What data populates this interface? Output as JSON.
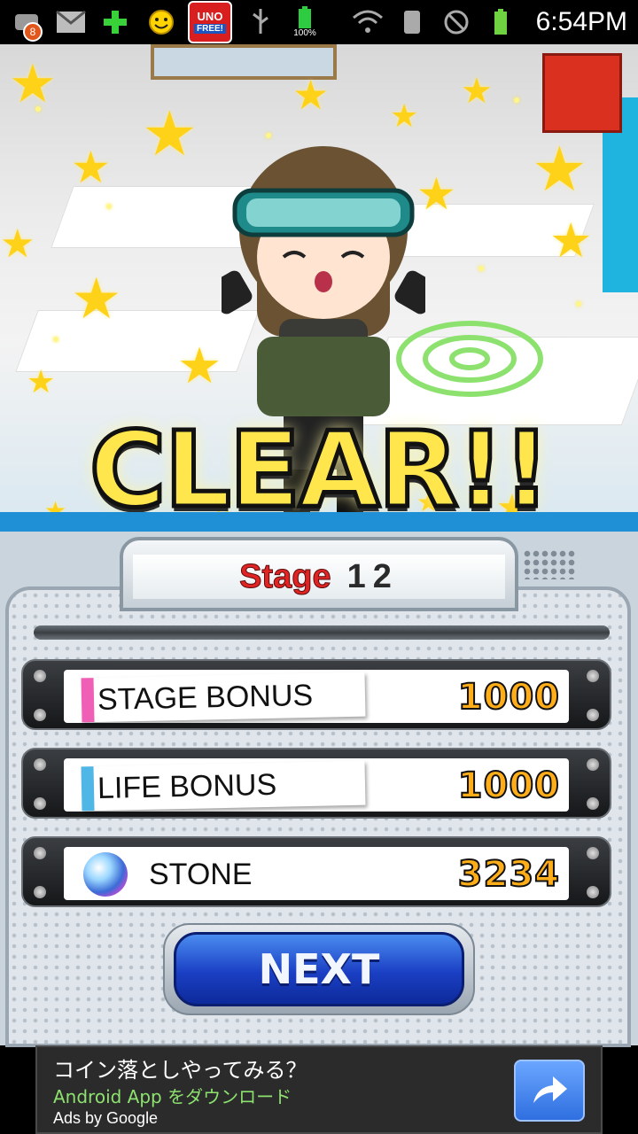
{
  "status_bar": {
    "notification_count": "8",
    "uno_label": "UNO",
    "uno_free": "FREE!",
    "battery_percent": "100%",
    "time": "6:54PM"
  },
  "game": {
    "clear_text": "CLEAR!!"
  },
  "result": {
    "stage_word": "Stage",
    "stage_number": "12",
    "rows": [
      {
        "label": "STAGE BONUS",
        "value": "1000",
        "accent": "#ef5fb6"
      },
      {
        "label": "LIFE BONUS",
        "value": "1000",
        "accent": "#4fb6e6"
      },
      {
        "label": "STONE",
        "value": "3234"
      }
    ],
    "next_label": "NEXT"
  },
  "ad": {
    "title": "コイン落としやってみる？",
    "subtitle": "Android App をダウンロード",
    "brand": "Ads by Google",
    "button_icon": "share-arrow-icon"
  }
}
